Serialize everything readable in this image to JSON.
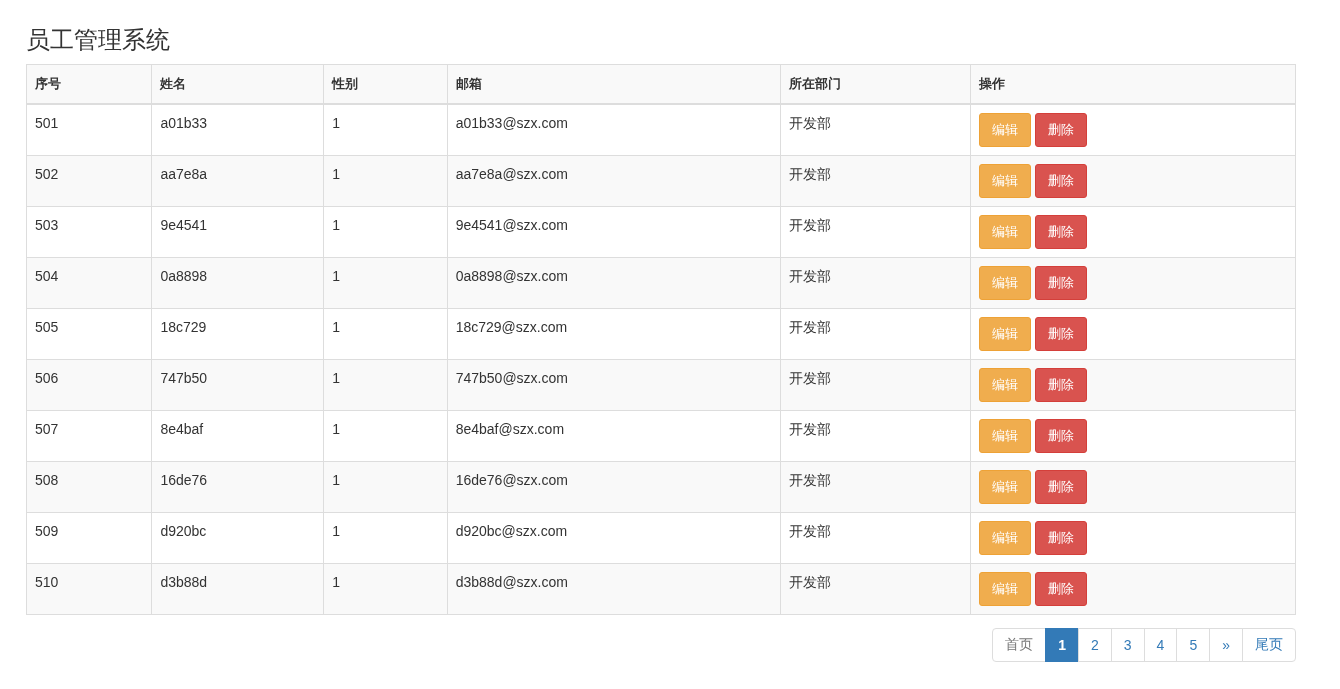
{
  "title": "员工管理系统",
  "table": {
    "columns": [
      "序号",
      "姓名",
      "性别",
      "邮箱",
      "所在部门",
      "操作"
    ],
    "rows": [
      {
        "cells": [
          "501",
          "a01b33",
          "1",
          "a01b33@szx.com",
          "开发部"
        ],
        "actions": [
          "编辑",
          "删除"
        ]
      },
      {
        "cells": [
          "502",
          "aa7e8a",
          "1",
          "aa7e8a@szx.com",
          "开发部"
        ],
        "actions": [
          "编辑",
          "删除"
        ]
      },
      {
        "cells": [
          "503",
          "9e4541",
          "1",
          "9e4541@szx.com",
          "开发部"
        ],
        "actions": [
          "编辑",
          "删除"
        ]
      },
      {
        "cells": [
          "504",
          "0a8898",
          "1",
          "0a8898@szx.com",
          "开发部"
        ],
        "actions": [
          "编辑",
          "删除"
        ]
      },
      {
        "cells": [
          "505",
          "18c729",
          "1",
          "18c729@szx.com",
          "开发部"
        ],
        "actions": [
          "编辑",
          "删除"
        ]
      },
      {
        "cells": [
          "506",
          "747b50",
          "1",
          "747b50@szx.com",
          "开发部"
        ],
        "actions": [
          "编辑",
          "删除"
        ]
      },
      {
        "cells": [
          "507",
          "8e4baf",
          "1",
          "8e4baf@szx.com",
          "开发部"
        ],
        "actions": [
          "编辑",
          "删除"
        ]
      },
      {
        "cells": [
          "508",
          "16de76",
          "1",
          "16de76@szx.com",
          "开发部"
        ],
        "actions": [
          "编辑",
          "删除"
        ]
      },
      {
        "cells": [
          "509",
          "d920bc",
          "1",
          "d920bc@szx.com",
          "开发部"
        ],
        "actions": [
          "编辑",
          "删除"
        ]
      },
      {
        "cells": [
          "510",
          "d3b88d",
          "1",
          "d3b88d@szx.com",
          "开发部"
        ],
        "actions": [
          "编辑",
          "删除"
        ]
      }
    ]
  },
  "pagination": [
    {
      "label": "首页",
      "selected": false
    },
    {
      "label": "1",
      "selected": true
    },
    {
      "label": "2",
      "selected": false
    },
    {
      "label": "3",
      "selected": false
    },
    {
      "label": "4",
      "selected": false
    },
    {
      "label": "5",
      "selected": false
    },
    {
      "label": "»",
      "selected": false
    },
    {
      "label": "尾页",
      "selected": false
    }
  ]
}
